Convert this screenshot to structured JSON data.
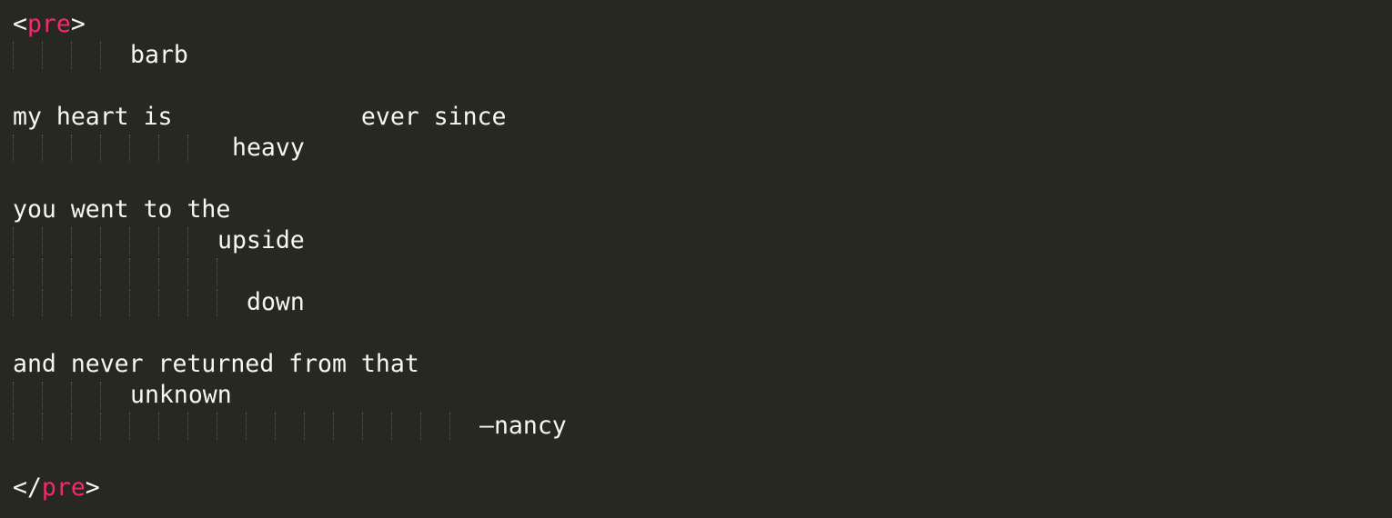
{
  "editor": {
    "open_tag": {
      "open_bracket": "<",
      "name": "pre",
      "close_bracket": ">"
    },
    "close_tag": {
      "open_bracket": "</",
      "name": "pre",
      "close_bracket": ">"
    },
    "lines": [
      "barb",
      "my heart is             ever since",
      "heavy",
      "you went to the",
      "upside",
      "down",
      "and never returned from that",
      "unknown",
      "—nancy"
    ],
    "colors": {
      "background": "#272822",
      "text": "#f8f8f2",
      "tag_name": "#f92672",
      "indent_guide": "#5a5b53"
    }
  }
}
